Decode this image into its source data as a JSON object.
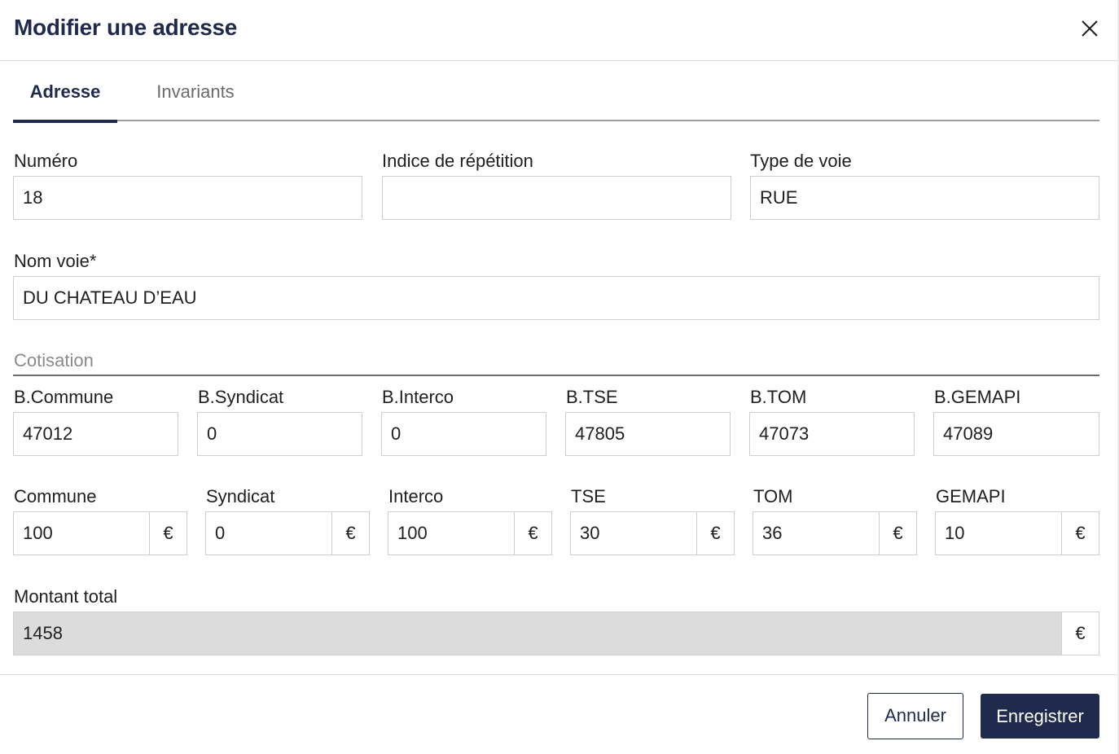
{
  "dialog": {
    "title": "Modifier une adresse",
    "close_icon": "close-icon"
  },
  "tabs": [
    {
      "label": "Adresse",
      "active": true
    },
    {
      "label": "Invariants",
      "active": false
    }
  ],
  "address": {
    "numero": {
      "label": "Numéro",
      "value": "18"
    },
    "indice": {
      "label": "Indice de répétition",
      "value": ""
    },
    "type_voie": {
      "label": "Type de voie",
      "value": "RUE"
    },
    "nom_voie": {
      "label": "Nom voie*",
      "value": "DU CHATEAU D’EAU"
    }
  },
  "cotisation": {
    "section_title": "Cotisation",
    "bases": [
      {
        "label": "B.Commune",
        "value": "47012"
      },
      {
        "label": "B.Syndicat",
        "value": "0"
      },
      {
        "label": "B.Interco",
        "value": "0"
      },
      {
        "label": "B.TSE",
        "value": "47805"
      },
      {
        "label": "B.TOM",
        "value": "47073"
      },
      {
        "label": "B.GEMAPI",
        "value": "47089"
      }
    ],
    "amounts": [
      {
        "label": "Commune",
        "value": "100",
        "currency": "€"
      },
      {
        "label": "Syndicat",
        "value": "0",
        "currency": "€"
      },
      {
        "label": "Interco",
        "value": "100",
        "currency": "€"
      },
      {
        "label": "TSE",
        "value": "30",
        "currency": "€"
      },
      {
        "label": "TOM",
        "value": "36",
        "currency": "€"
      },
      {
        "label": "GEMAPI",
        "value": "10",
        "currency": "€"
      }
    ],
    "total": {
      "label": "Montant total",
      "value": "1458",
      "currency": "€"
    }
  },
  "footer": {
    "cancel_label": "Annuler",
    "save_label": "Enregistrer"
  },
  "colors": {
    "primary": "#1f2a4c",
    "readonly_bg": "#dcdcdc",
    "border": "#cfcfcf"
  }
}
